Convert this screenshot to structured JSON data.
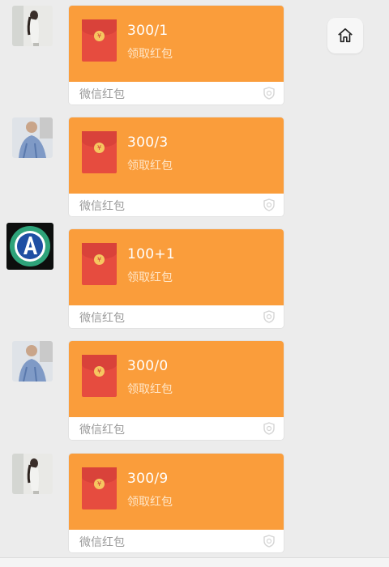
{
  "home_button": {
    "icon": "home-icon"
  },
  "messages": [
    {
      "amount": "300/1",
      "action": "领取红包",
      "label": "微信红包"
    },
    {
      "amount": "300/3",
      "action": "领取红包",
      "label": "微信红包"
    },
    {
      "amount": "100+1",
      "action": "领取红包",
      "label": "微信红包"
    },
    {
      "amount": "300/0",
      "action": "领取红包",
      "label": "微信红包"
    },
    {
      "amount": "300/9",
      "action": "领取红包",
      "label": "微信红包"
    }
  ],
  "colors": {
    "card": "#fa9d3b",
    "envelope": "#e64c3f",
    "background": "#ececec"
  }
}
